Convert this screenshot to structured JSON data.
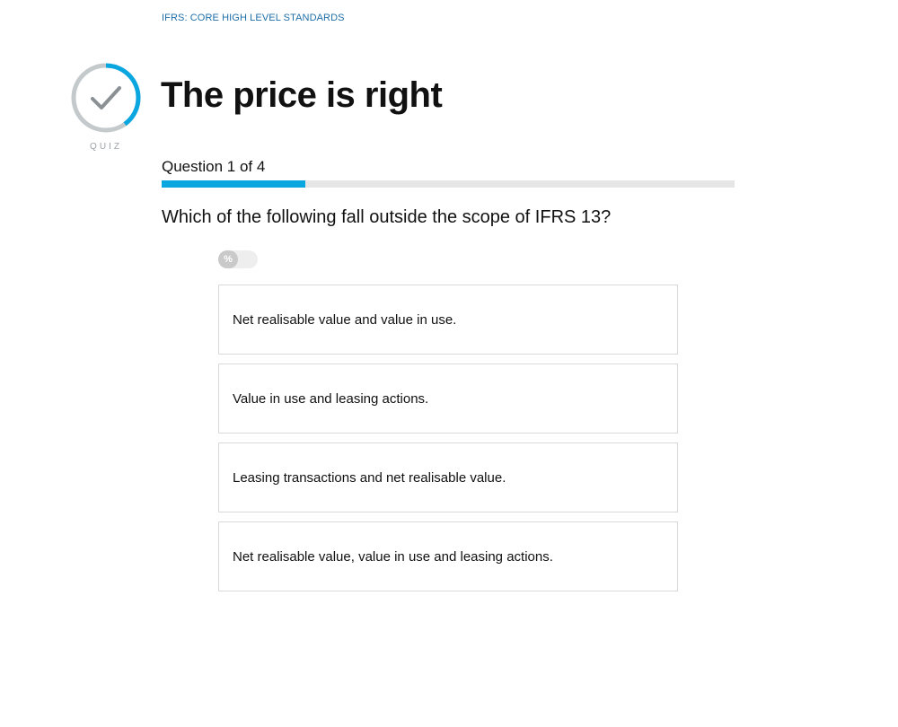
{
  "breadcrumb": "IFRS: CORE HIGH LEVEL STANDARDS",
  "badge": {
    "label": "QUIZ",
    "icon": "check-icon",
    "ring_color": "#c4c9cc",
    "accent_color": "#0aa6e0",
    "ring_progress": 0.4
  },
  "title": "The price is right",
  "progress": {
    "label": "Question 1 of 4",
    "current": 1,
    "total": 4,
    "fraction": 0.25,
    "color": "#0aa6e0"
  },
  "question": "Which of the following fall outside the scope of IFRS 13?",
  "toggle": {
    "symbol": "%",
    "state": "off"
  },
  "answers": [
    "Net realisable value and value in use.",
    "Value in use and leasing actions.",
    "Leasing transactions and net realisable value.",
    "Net realisable value, value in use and leasing actions."
  ]
}
